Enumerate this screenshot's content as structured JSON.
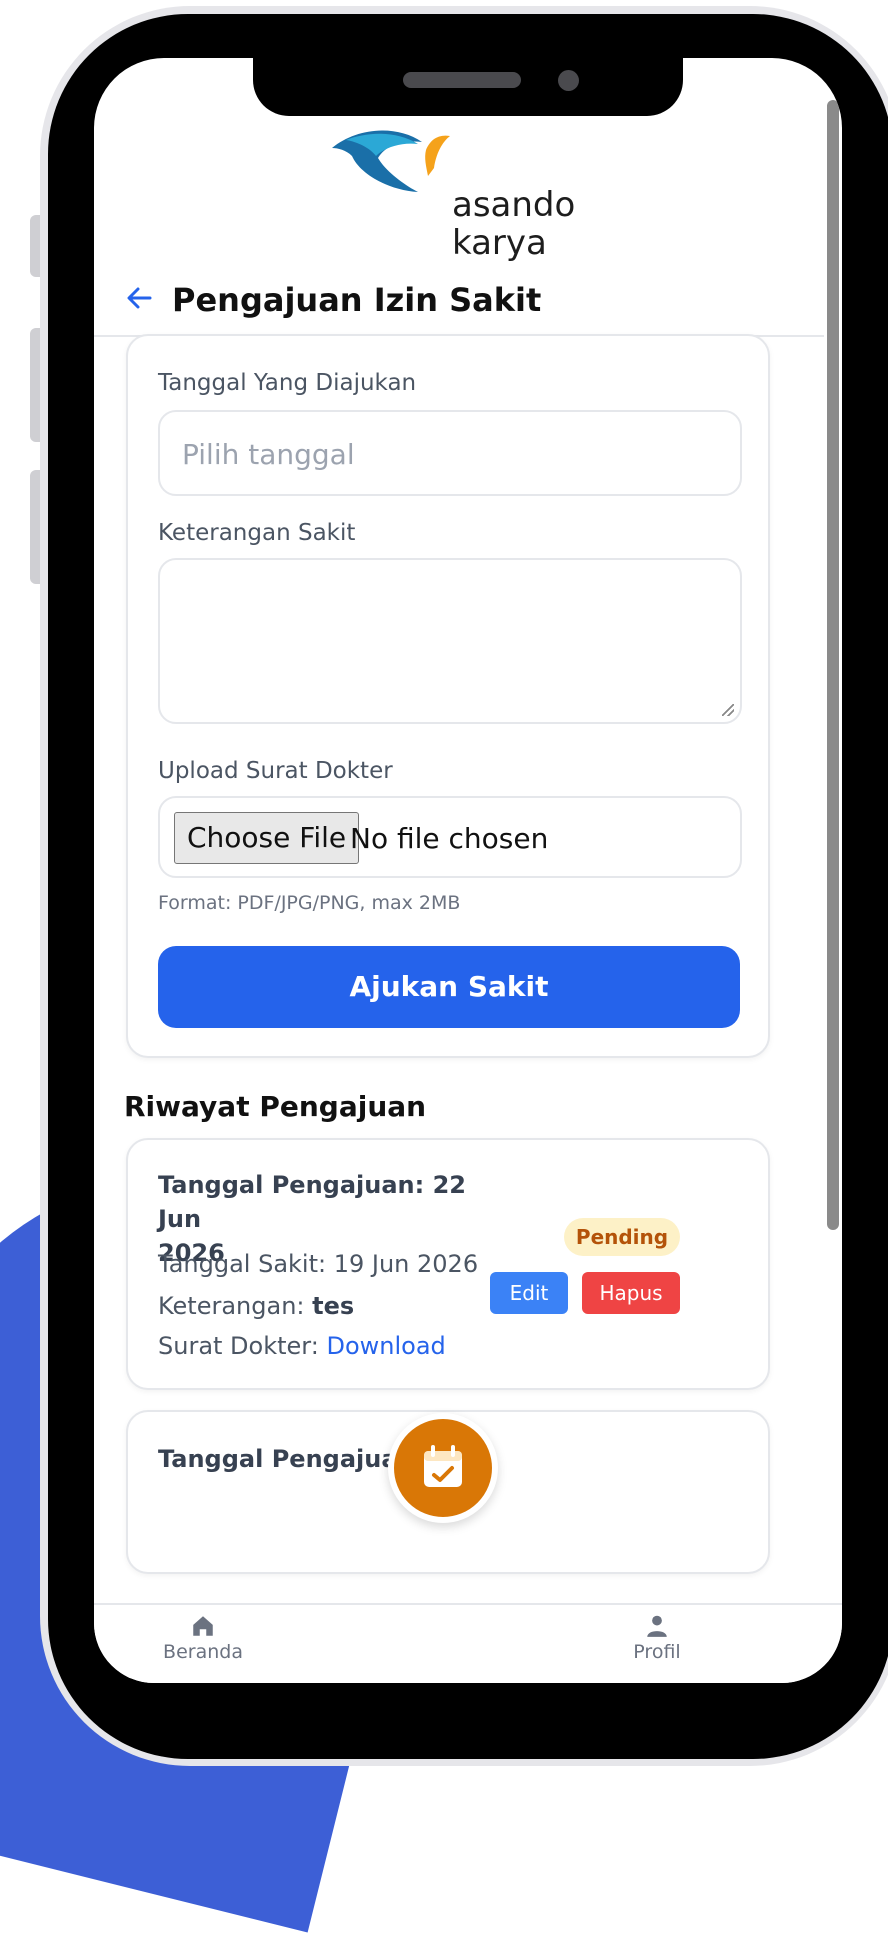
{
  "brand": {
    "line1": "asando",
    "line2": "karya"
  },
  "header": {
    "back_icon": "arrow-left-icon",
    "title": "Pengajuan Izin Sakit"
  },
  "form": {
    "date_label": "Tanggal Yang Diajukan",
    "date_placeholder": "Pilih tanggal",
    "reason_label": "Keterangan Sakit",
    "reason_value": "",
    "upload_label": "Upload Surat Dokter",
    "file_button": "Choose File",
    "file_status": "No file chosen",
    "hint": "Format: PDF/JPG/PNG, max 2MB",
    "submit": "Ajukan Sakit"
  },
  "history": {
    "title": "Riwayat Pengajuan",
    "items": [
      {
        "submitted_line1": "Tanggal Pengajuan: 22 Jun",
        "submitted_line2": "2026",
        "sick_date": "Tanggal Sakit: 19 Jun 2026",
        "reason_label": "Keterangan: ",
        "reason_value": "tes",
        "doc_label": "Surat Dokter: ",
        "doc_link": "Download",
        "status": "Pending",
        "edit": "Edit",
        "delete": "Hapus"
      },
      {
        "submitted_line1": "Tanggal Pengajuan: 0"
      }
    ]
  },
  "nav": {
    "home": "Beranda",
    "home_icon": "home-icon",
    "fab_icon": "calendar-check-icon",
    "profile": "Profil",
    "profile_icon": "user-icon"
  },
  "colors": {
    "primary": "#2563eb",
    "danger": "#ef4444",
    "pending_bg": "#fdf1c7",
    "pending_text": "#b45309",
    "fab": "#d97706",
    "background_accent": "#3d5fd6"
  }
}
